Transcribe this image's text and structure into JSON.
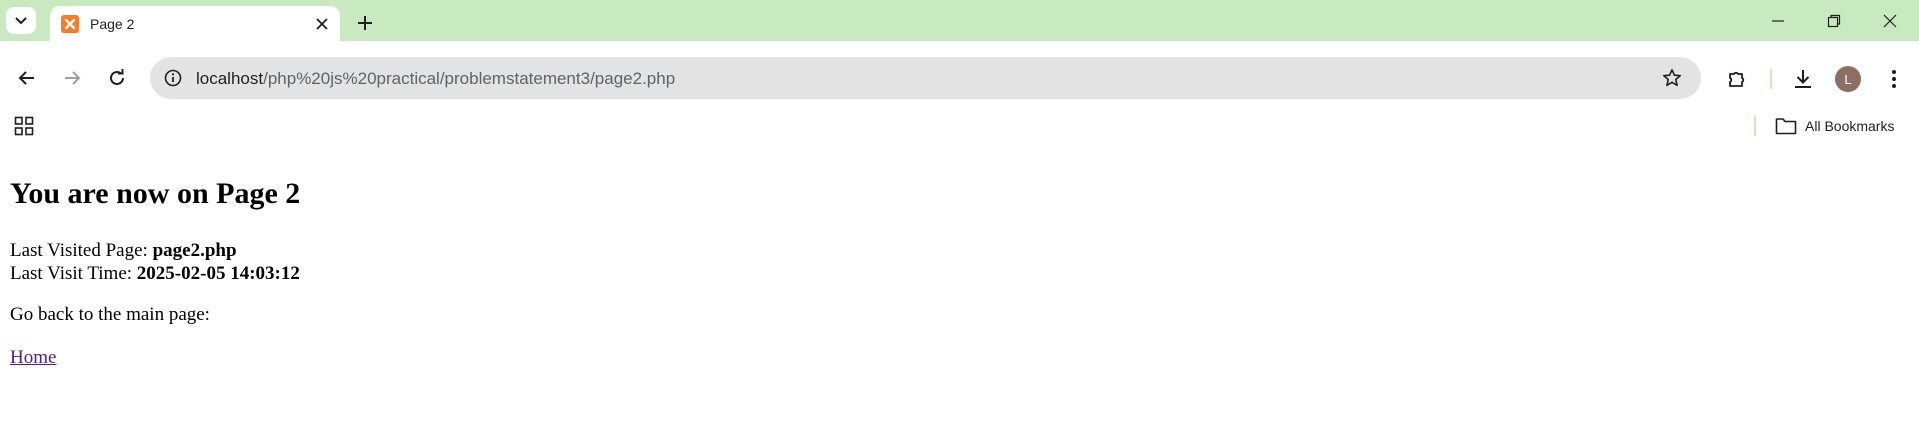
{
  "browser": {
    "tab": {
      "title": "Page 2"
    },
    "address_bar": {
      "host": "localhost",
      "path": "/php%20js%20practical/problemstatement3/page2.php"
    },
    "bookmarks_bar": {
      "all_bookmarks_label": "All Bookmarks"
    },
    "profile_initial": "L",
    "colors": {
      "tabstrip": "#c9e9c1",
      "favicon": "#fb7a24",
      "omnibox": "#e3e3e3",
      "avatar": "#8d6e63"
    }
  },
  "page": {
    "heading": "You are now on Page 2",
    "last_visited_label": "Last Visited Page: ",
    "last_visited_value": "page2.php",
    "last_visit_time_label": "Last Visit Time: ",
    "last_visit_time_value": "2025-02-05 14:03:12",
    "go_back_text": "Go back to the main page:",
    "home_link": "Home"
  }
}
